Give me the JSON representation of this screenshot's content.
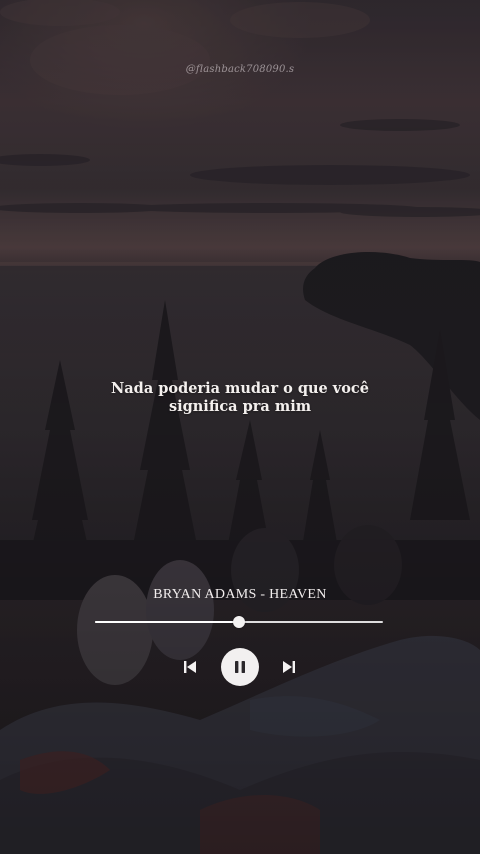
{
  "watermark": "@flashback708090.s",
  "lyric": {
    "line1": "Nada poderia mudar o que você",
    "line2": "significa pra mim"
  },
  "player": {
    "song_title": "BRYAN ADAMS - HEAVEN",
    "progress": 0.5,
    "state": "playing",
    "icons": {
      "previous": "skip-previous-icon",
      "pause": "pause-icon",
      "next": "skip-next-icon"
    }
  },
  "colors": {
    "overlay": "#1c1a1d",
    "text": "#f4f0ee",
    "control_fill": "#f2f0f0"
  }
}
